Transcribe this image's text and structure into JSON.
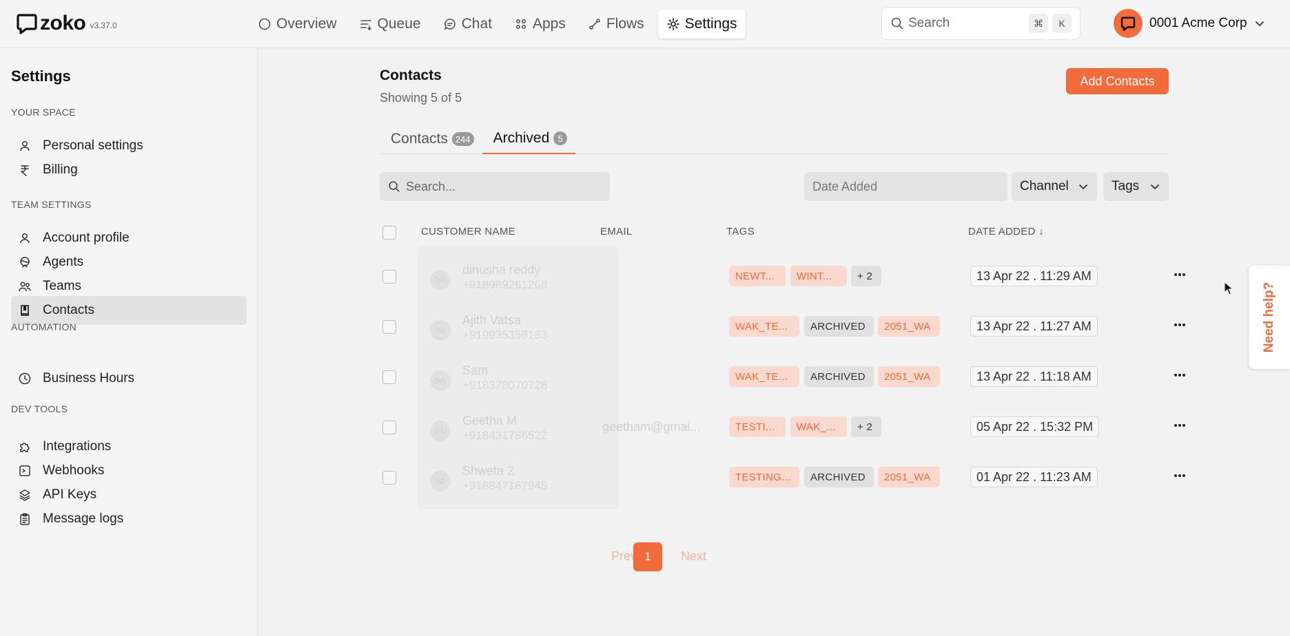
{
  "app": {
    "brand": "zoko",
    "version": "v3.37.0",
    "accent": "#f26b3a"
  },
  "nav": [
    {
      "label": "Overview",
      "icon": "circle-icon"
    },
    {
      "label": "Queue",
      "icon": "queue-icon"
    },
    {
      "label": "Chat",
      "icon": "chat-icon"
    },
    {
      "label": "Apps",
      "icon": "apps-icon"
    },
    {
      "label": "Flows",
      "icon": "flows-icon"
    },
    {
      "label": "Settings",
      "icon": "gear-icon",
      "active": true
    }
  ],
  "top_search": {
    "placeholder": "Search",
    "shortcut_mod": "⌘",
    "shortcut_key": "K"
  },
  "org": {
    "name": "0001 Acme Corp"
  },
  "sidebar": {
    "title": "Settings",
    "sections": {
      "your_space": "YOUR SPACE",
      "team_settings": "TEAM SETTINGS",
      "automation": "AUTOMATION",
      "dev_tools": "DEV TOOLS"
    },
    "items": {
      "personal_settings": "Personal settings",
      "billing": "Billing",
      "account_profile": "Account profile",
      "agents": "Agents",
      "teams": "Teams",
      "contacts": "Contacts",
      "business_hours": "Business Hours",
      "integrations": "Integrations",
      "webhooks": "Webhooks",
      "api_keys": "API Keys",
      "message_logs": "Message logs"
    }
  },
  "page": {
    "title": "Contacts",
    "subtitle": "Showing 5 of 5",
    "add_button": "Add Contacts",
    "tabs": [
      {
        "label": "Contacts",
        "count": "244"
      },
      {
        "label": "Archived",
        "count": "5",
        "active": true
      }
    ],
    "search_placeholder": "Search...",
    "date_placeholder": "Date Added",
    "channel_label": "Channel",
    "tags_label": "Tags"
  },
  "table": {
    "headers": {
      "name": "CUSTOMER NAME",
      "email": "EMAIL",
      "tags": "TAGS",
      "date": "DATE ADDED ↓"
    },
    "rows": [
      {
        "initials": "DR",
        "name": "dinusha reddy",
        "phone": "+918989261268",
        "email": "",
        "tags": [
          {
            "t": "NEWT...",
            "c": "orange"
          },
          {
            "t": "WINT...",
            "c": "orange"
          },
          {
            "t": "+ 2",
            "c": "gray"
          }
        ],
        "date": "13 Apr 22 . 11:29 AM"
      },
      {
        "initials": "AV",
        "name": "Ajith Vatsa",
        "phone": "+919935358183",
        "email": "",
        "tags": [
          {
            "t": "WAK_TE...",
            "c": "orange"
          },
          {
            "t": "ARCHIVED",
            "c": "gray"
          },
          {
            "t": "2051_WA",
            "c": "orange"
          }
        ],
        "date": "13 Apr 22 . 11:27 AM"
      },
      {
        "initials": "SA",
        "name": "Sam",
        "phone": "+918378070728",
        "email": "",
        "tags": [
          {
            "t": "WAK_TE...",
            "c": "orange"
          },
          {
            "t": "ARCHIVED",
            "c": "gray"
          },
          {
            "t": "2051_WA",
            "c": "orange"
          }
        ],
        "date": "13 Apr 22 . 11:18 AM"
      },
      {
        "initials": "GM",
        "name": "Geetha M",
        "phone": "+918431786522",
        "email": "geetham@gmai...",
        "tags": [
          {
            "t": "TESTI...",
            "c": "orange"
          },
          {
            "t": "WAK_...",
            "c": "orange"
          },
          {
            "t": "+ 2",
            "c": "gray"
          }
        ],
        "date": "05 Apr 22 . 15:32 PM"
      },
      {
        "initials": "S2",
        "name": "Shweta 2",
        "phone": "+918847187945",
        "email": "",
        "tags": [
          {
            "t": "TESTING...",
            "c": "orange"
          },
          {
            "t": "ARCHIVED",
            "c": "gray"
          },
          {
            "t": "2051_WA",
            "c": "orange"
          }
        ],
        "date": "01 Apr 22 . 11:23 AM"
      }
    ]
  },
  "pagination": {
    "prev": "Prev",
    "page": "1",
    "next": "Next"
  },
  "help": {
    "label": "Need help?"
  }
}
